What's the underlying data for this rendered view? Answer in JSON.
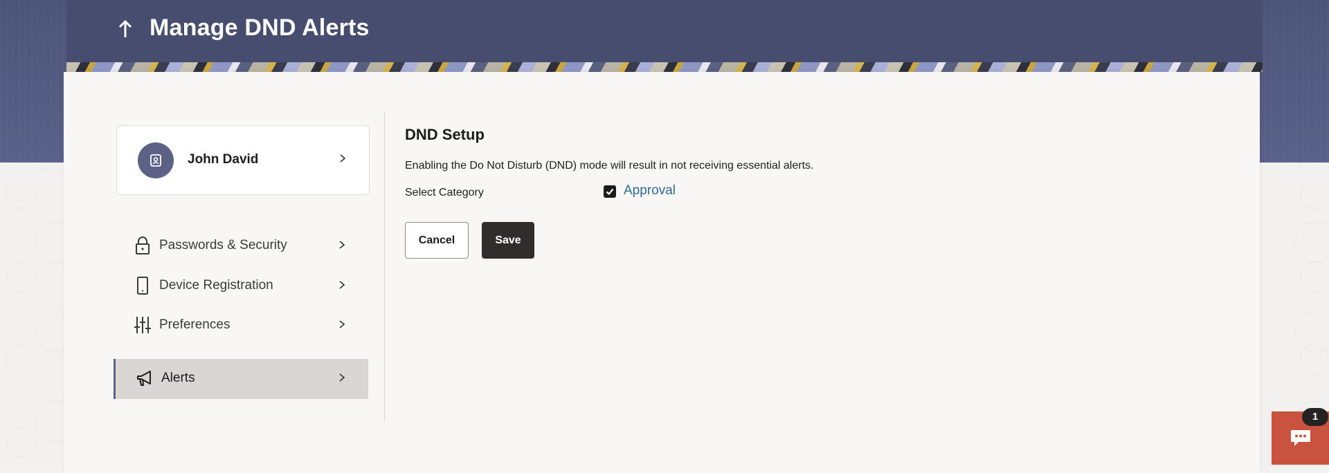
{
  "header": {
    "title": "Manage DND Alerts",
    "back_icon": "arrow-up-icon"
  },
  "profile": {
    "name": "John David",
    "avatar_icon": "contact-card-icon"
  },
  "sidebar": {
    "items": [
      {
        "label": "Passwords & Security",
        "icon": "lock-icon",
        "active": false
      },
      {
        "label": "Device Registration",
        "icon": "phone-icon",
        "active": false
      },
      {
        "label": "Preferences",
        "icon": "sliders-icon",
        "active": false
      },
      {
        "label": "Alerts",
        "icon": "megaphone-icon",
        "active": true
      }
    ]
  },
  "content": {
    "section_title": "DND Setup",
    "description": "Enabling the Do Not Disturb (DND) mode will result in not receiving essential alerts.",
    "select_category_label": "Select Category",
    "categories": [
      {
        "label": "Approval",
        "checked": true
      }
    ],
    "cancel_label": "Cancel",
    "save_label": "Save"
  },
  "chat": {
    "badge_count": "1",
    "icon": "chat-bubble-icon"
  },
  "colors": {
    "header_bg": "#474d6e",
    "accent": "#5b6285",
    "save_button": "#312d2a",
    "link": "#2e6b8f",
    "chat_widget": "#c9533e"
  }
}
